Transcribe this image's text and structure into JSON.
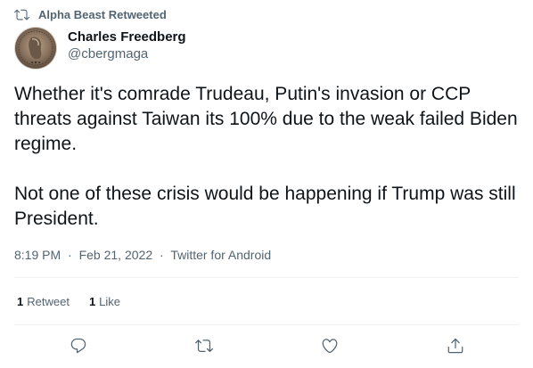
{
  "retweet_header": {
    "text": "Alpha Beast Retweeted",
    "icon": "retweet-icon"
  },
  "author": {
    "display_name": "Charles Freedberg",
    "handle": "@cbergmaga",
    "avatar": "coin-avatar"
  },
  "tweet": {
    "paragraphs": [
      "Whether it's comrade Trudeau, Putin's invasion or CCP threats against Taiwan its 100% due to the weak failed Biden regime.",
      "Not one of these crisis would be happening if Trump was still President."
    ]
  },
  "meta": {
    "time": "8:19 PM",
    "separator": "·",
    "date": "Feb 21, 2022",
    "source": "Twitter for Android"
  },
  "stats": {
    "retweets_count": "1",
    "retweets_label": "Retweet",
    "likes_count": "1",
    "likes_label": "Like"
  },
  "actions": {
    "icons": [
      "reply-icon",
      "retweet-icon",
      "like-icon",
      "share-icon"
    ]
  },
  "colors": {
    "text": "#0f1419",
    "secondary": "#536471",
    "divider": "#eff3f4"
  }
}
